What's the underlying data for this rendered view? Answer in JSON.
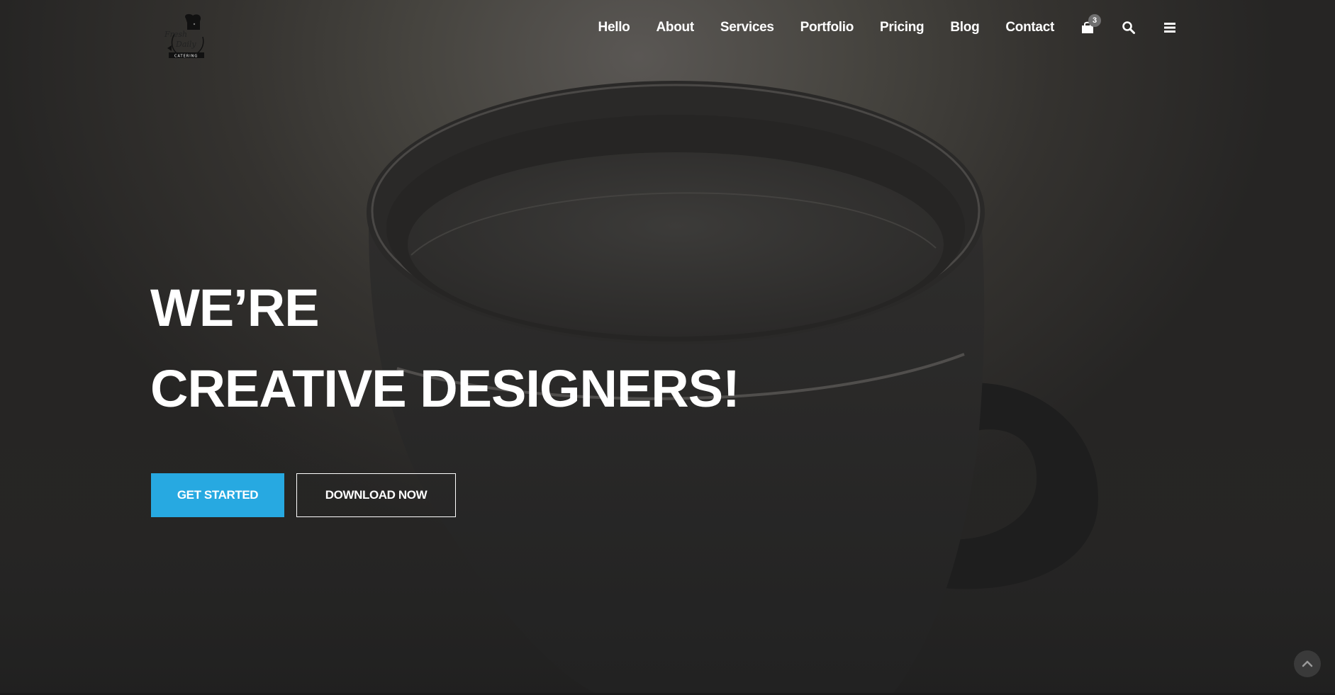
{
  "logo": {
    "line1": "Fresh",
    "line2": "Daily",
    "line3": "CATERING"
  },
  "nav": {
    "items": [
      {
        "label": "Hello"
      },
      {
        "label": "About"
      },
      {
        "label": "Services"
      },
      {
        "label": "Portfolio"
      },
      {
        "label": "Pricing"
      },
      {
        "label": "Blog"
      },
      {
        "label": "Contact"
      }
    ],
    "cart_count": "3",
    "icons": [
      "shopping-bag-icon",
      "search-icon",
      "menu-icon"
    ]
  },
  "hero": {
    "headline_line1": "WE’RE",
    "headline_line2": "CREATIVE DESIGNERS!",
    "primary_button": "GET STARTED",
    "secondary_button": "DOWNLOAD NOW"
  },
  "colors": {
    "accent": "#27a9e1",
    "text": "#ffffff",
    "background": "#2f2e2c"
  }
}
